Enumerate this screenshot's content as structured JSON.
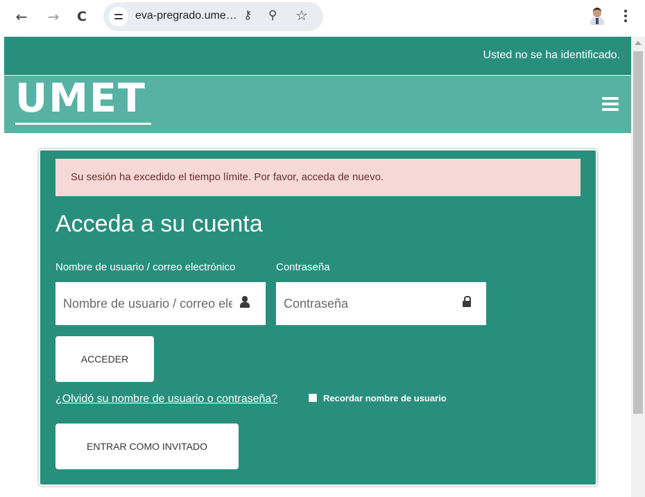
{
  "browser": {
    "url": "eva-pregrado.ume…",
    "back_icon": "←",
    "forward_icon": "→",
    "reload_icon": "C",
    "key_icon": "⚷",
    "zoom_icon": "⚲",
    "star_icon": "☆"
  },
  "topbar": {
    "login_status": "Usted no se ha identificado.",
    "color": "#298f7d"
  },
  "brand": {
    "logo_text": "UMET",
    "color": "#58b2a3"
  },
  "alert": {
    "text": "Su sesión ha excedido el tiempo límite. Por favor, acceda de nuevo.",
    "background": "#f4d9d7"
  },
  "login": {
    "heading": "Acceda a su cuenta",
    "username_label": "Nombre de usuario / correo electrónico",
    "username_placeholder": "Nombre de usuario / correo electrónico",
    "password_label": "Contraseña",
    "password_placeholder": "Contraseña",
    "submit_label": "ACCEDER",
    "forgot_link": "¿Olvidó su nombre de usuario o contraseña?",
    "remember_label": "Recordar nombre de usuario",
    "guest_label": "ENTRAR COMO INVITADO"
  }
}
